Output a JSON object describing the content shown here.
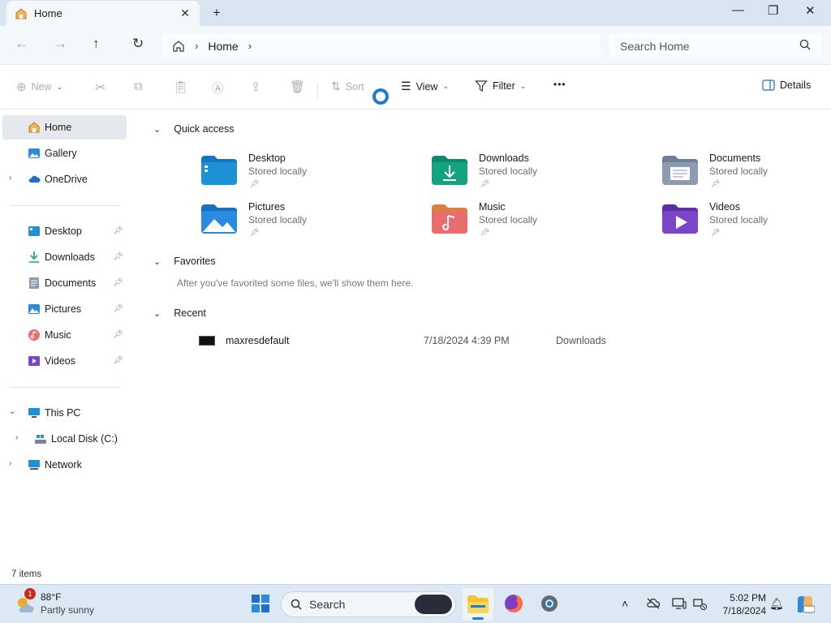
{
  "window": {
    "tab_title": "Home",
    "new_tab": "+",
    "close_tab": "✕",
    "minimize": "—",
    "maximize": "❐",
    "close": "✕"
  },
  "address": {
    "breadcrumb": "Home",
    "search_placeholder": "Search Home"
  },
  "toolbar": {
    "new_label": "New",
    "sort_label": "Sort",
    "view_label": "View",
    "filter_label": "Filter",
    "more_label": "•••",
    "details_label": "Details"
  },
  "sidebar": {
    "top": [
      {
        "label": "Home"
      },
      {
        "label": "Gallery"
      },
      {
        "label": "OneDrive"
      }
    ],
    "pinned": [
      {
        "label": "Desktop"
      },
      {
        "label": "Downloads"
      },
      {
        "label": "Documents"
      },
      {
        "label": "Pictures"
      },
      {
        "label": "Music"
      },
      {
        "label": "Videos"
      }
    ],
    "devices": [
      {
        "label": "This PC"
      },
      {
        "label": "Local Disk (C:)"
      },
      {
        "label": "Network"
      }
    ]
  },
  "main": {
    "quick_access": {
      "title": "Quick access",
      "items": [
        {
          "name": "Desktop",
          "sub": "Stored locally",
          "color": "#1e90d6"
        },
        {
          "name": "Downloads",
          "sub": "Stored locally",
          "color": "#14a37f"
        },
        {
          "name": "Documents",
          "sub": "Stored locally",
          "color": "#8a9bb2"
        },
        {
          "name": "Pictures",
          "sub": "Stored locally",
          "color": "#2a8ae0"
        },
        {
          "name": "Music",
          "sub": "Stored locally",
          "color": "#e86e6e"
        },
        {
          "name": "Videos",
          "sub": "Stored locally",
          "color": "#7a45c8"
        }
      ]
    },
    "favorites": {
      "title": "Favorites",
      "empty": "After you've favorited some files, we'll show them here."
    },
    "recent": {
      "title": "Recent",
      "items": [
        {
          "name": "maxresdefault",
          "date": "7/18/2024 4:39 PM",
          "location": "Downloads"
        }
      ]
    }
  },
  "status": {
    "count": "7 items"
  },
  "taskbar": {
    "weather_temp": "88°F",
    "weather_desc": "Partly sunny",
    "weather_badge": "1",
    "search_label": "Search",
    "time": "5:02 PM",
    "date": "7/18/2024"
  }
}
